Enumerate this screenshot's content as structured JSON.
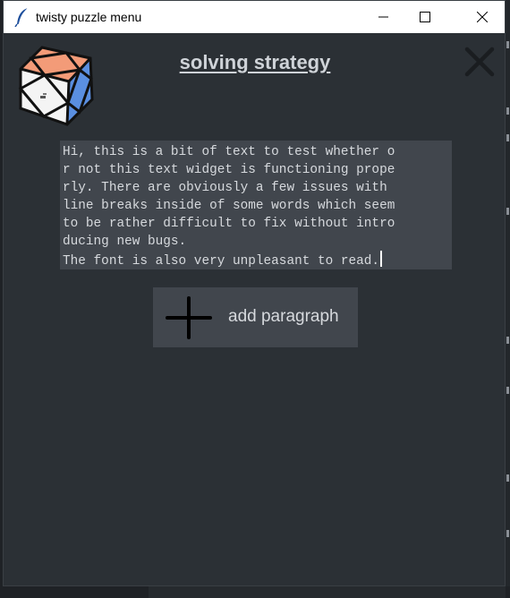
{
  "window": {
    "title": "twisty puzzle menu",
    "icon": "feather-icon",
    "controls": [
      "minimize-icon",
      "maximize-icon",
      "close-icon"
    ]
  },
  "page": {
    "title": "solving strategy",
    "close_icon": "x-close-icon",
    "logo": "skewb-puzzle-logo"
  },
  "editor": {
    "lines": [
      "Hi, this is a bit of text to test whether o",
      "r not this text widget is functioning prope",
      "rly. There are obviously a few issues with ",
      "line breaks inside of some words which seem",
      "to be rather difficult to fix without intro",
      "ducing new bugs.",
      "The font is also very unpleasant to read."
    ]
  },
  "add_button": {
    "label": "add paragraph",
    "icon": "plus-icon"
  },
  "colors": {
    "background": "#2b3035",
    "panel": "#41464d",
    "text": "#d6d9dd",
    "title": "#cfd3d8",
    "logo_top": "#f39b78",
    "logo_right": "#5a8fe0",
    "logo_left": "#f4f4f4"
  }
}
